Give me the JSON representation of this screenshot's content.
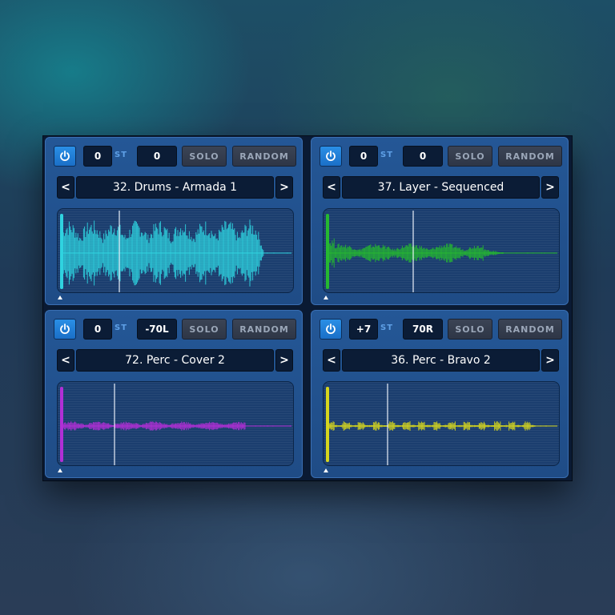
{
  "pads": [
    {
      "tune": "0",
      "st_label": "ST",
      "pan": "0",
      "solo_label": "SOLO",
      "random_label": "RANDOM",
      "prev_label": "<",
      "next_label": ">",
      "preset": "32. Drums - Armada 1",
      "icon": "power-icon",
      "color": "#2fd3e0",
      "playhead": 0.26
    },
    {
      "tune": "0",
      "st_label": "ST",
      "pan": "0",
      "solo_label": "SOLO",
      "random_label": "RANDOM",
      "prev_label": "<",
      "next_label": ">",
      "preset": "37. Layer - Sequenced",
      "icon": "power-icon",
      "color": "#25b830",
      "playhead": 0.38
    },
    {
      "tune": "0",
      "st_label": "ST",
      "pan": "-70L",
      "solo_label": "SOLO",
      "random_label": "RANDOM",
      "prev_label": "<",
      "next_label": ">",
      "preset": "72. Perc - Cover 2",
      "icon": "power-icon",
      "color": "#b12fd6",
      "playhead": 0.24
    },
    {
      "tune": "+7",
      "st_label": "ST",
      "pan": "70R",
      "solo_label": "SOLO",
      "random_label": "RANDOM",
      "prev_label": "<",
      "next_label": ">",
      "preset": "36. Perc - Bravo 2",
      "icon": "power-icon",
      "color": "#d6d61e",
      "playhead": 0.27
    }
  ]
}
